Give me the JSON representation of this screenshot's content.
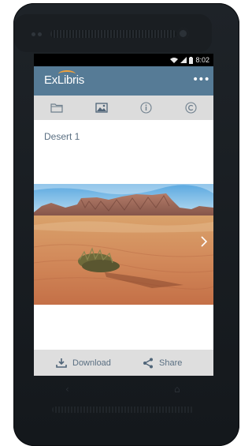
{
  "status_bar": {
    "time": "8:02",
    "wifi_icon": "wifi-icon",
    "signal_icon": "signal-icon",
    "battery_icon": "battery-icon"
  },
  "app_bar": {
    "logo_text": "ExLibris",
    "menu_icon": "more-dots-icon",
    "color": "#567b96",
    "accent": "#f2a23a"
  },
  "tabs": [
    {
      "icon": "folder-icon",
      "active": false
    },
    {
      "icon": "image-icon",
      "active": true
    },
    {
      "icon": "info-icon",
      "active": false
    },
    {
      "icon": "copyright-icon",
      "active": false
    }
  ],
  "item": {
    "title": "Desert 1",
    "image": "desert-landscape-photo"
  },
  "bottom_bar": {
    "download_label": "Download",
    "share_label": "Share"
  },
  "colors": {
    "text_accent": "#5a6f82",
    "tab_bg": "#dcdcdc",
    "bottom_bg": "#dedede"
  }
}
